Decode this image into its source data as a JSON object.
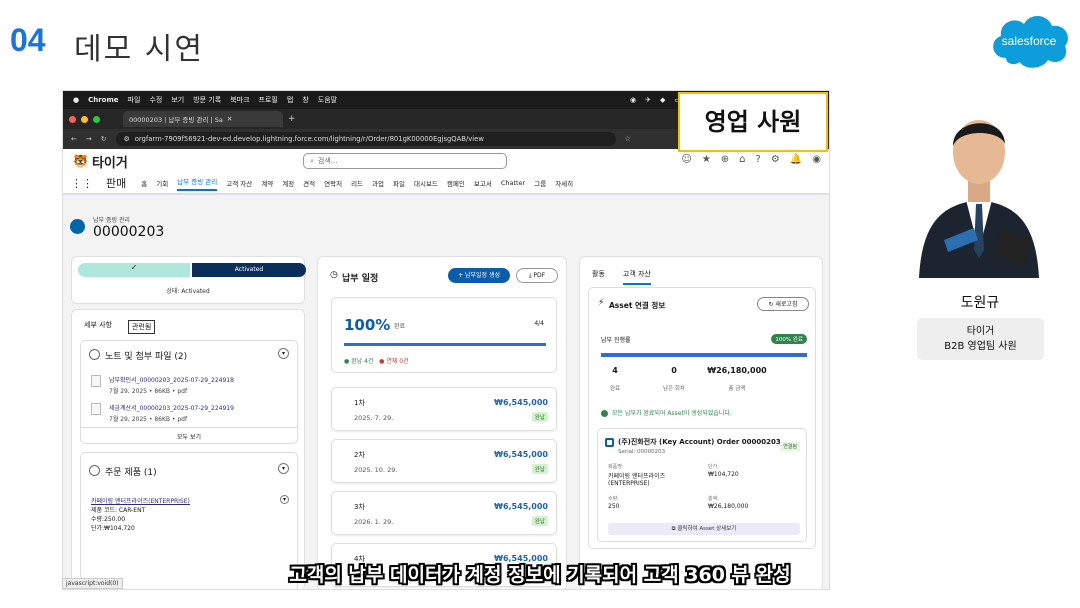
{
  "slide": {
    "number": "04",
    "title": "데모 시연",
    "logo": "salesforce"
  },
  "mac_menu": {
    "apple": "",
    "items": [
      "Chrome",
      "파일",
      "수정",
      "보기",
      "방문 기록",
      "북마크",
      "프로필",
      "탭",
      "창",
      "도움말"
    ]
  },
  "browser": {
    "tab_title": "00000203 | 납부 증빙 관리 | Sa",
    "url": "orgfarm-7909f56921-dev-ed.develop.lightning.force.com/lightning/r/Order/801gK00000EgjsgQAB/view"
  },
  "sf_header": {
    "brand": "타이거",
    "search_placeholder": "검색..."
  },
  "nav": {
    "app": "판매",
    "items": [
      "홈",
      "기회",
      "납부 증빙 관리",
      "고객 자산",
      "계약",
      "계정",
      "견적",
      "연락처",
      "리드",
      "과업",
      "파일",
      "대시보드",
      "캠페인",
      "보고서",
      "Chatter",
      "그룹",
      "자세히"
    ],
    "active": "납부 증빙 관리"
  },
  "record": {
    "object": "납부 증빙 관리",
    "name": "00000203"
  },
  "path": {
    "step1": "✓",
    "step2": "Activated",
    "status": "상태: Activated"
  },
  "left": {
    "tabs": [
      "세부 사항",
      "관련됨"
    ],
    "notes_title": "노트 및 첨부 파일 (2)",
    "files": [
      {
        "name": "납부확인서_00000203_2025-07-29_224918",
        "meta": "7월 29, 2025 • 86KB • pdf"
      },
      {
        "name": "세금계산서_00000203_2025-07-29_224919",
        "meta": "7월 29, 2025 • 86KB • pdf"
      }
    ],
    "view_all": "모두 보기",
    "products_title": "주문 제품 (1)",
    "product": {
      "name": "카페이링 엔터프라이즈(ENTERPRISE)",
      "code": "제품 코드: CAR-ENT",
      "qty": "수량:250.00",
      "price": "단가:₩104,720"
    }
  },
  "schedule": {
    "title": "납부 일정",
    "create_btn": "+ 납부일정 생성",
    "pdf_btn": "PDF",
    "percent": "100%",
    "percent_label": "완료",
    "count": "4/4",
    "legend_paid": "● 완납 4건",
    "legend_overdue": "● 연체 0건",
    "progress": 1.0,
    "installments": [
      {
        "no": "1차",
        "date": "2025. 7. 29.",
        "amount": "₩6,545,000",
        "status": "완납"
      },
      {
        "no": "2차",
        "date": "2025. 10. 29.",
        "amount": "₩6,545,000",
        "status": "완납"
      },
      {
        "no": "3차",
        "date": "2026. 1. 29.",
        "amount": "₩6,545,000",
        "status": "완납"
      },
      {
        "no": "4차",
        "date": "",
        "amount": "₩6,545,000",
        "status": ""
      }
    ]
  },
  "right": {
    "tabs": [
      "활동",
      "고객 자산"
    ],
    "asset_title": "Asset 연결 정보",
    "refresh": "새로고침",
    "progress_label": "납부 진행률",
    "progress_badge": "100% 완료",
    "progress": 1.0,
    "stats": [
      {
        "value": "4",
        "label": "완료"
      },
      {
        "value": "0",
        "label": "남은 회차"
      },
      {
        "value": "₩26,180,000",
        "label": "총 금액"
      }
    ],
    "ok_msg": "모든 납부가 완료되어 Asset이 생성되었습니다.",
    "order": {
      "title": "(주)진화전자 (Key Account) Order 00000203",
      "serial": "Serial: 00000203",
      "status": "연결됨",
      "product_label": "제품명:",
      "product": "카페이링 엔터프라이즈 (ENTERPRISE)",
      "price_label": "단가:",
      "price": "₩104,720",
      "qty_label": "수량:",
      "qty": "250",
      "total_label": "총액:",
      "total": "₩26,180,000",
      "button": "클릭하여 Asset 상세보기"
    }
  },
  "overlay": {
    "role": "영업 사원",
    "subtitle": "고객의 납부 데이터가 계정 정보에 기록되어 고객 360 뷰 완성",
    "status_url": "javascript:void(0)"
  },
  "presenter": {
    "name": "도원규",
    "company": "타이거",
    "title": "B2B 영업팀 사원"
  }
}
